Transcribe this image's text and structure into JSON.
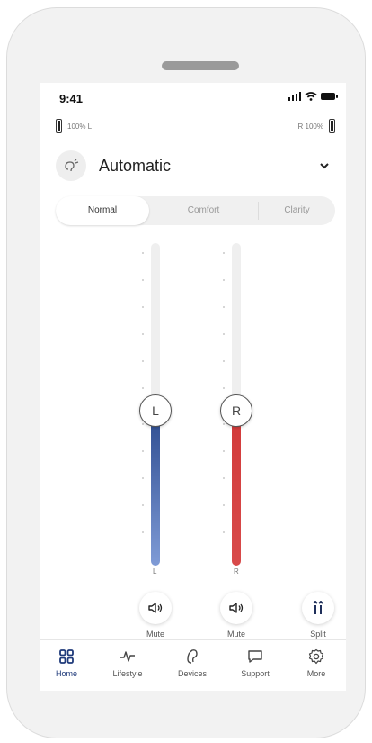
{
  "status": {
    "time": "9:41"
  },
  "battery": {
    "left_text": "100% L",
    "right_text": "R 100%"
  },
  "program": {
    "icon": "hearing-program-icon",
    "name": "Automatic"
  },
  "modes": {
    "items": [
      "Normal",
      "Comfort",
      "Clarity"
    ],
    "selected": "Normal"
  },
  "sliders": {
    "left": {
      "knob": "L",
      "bottom_label": "L",
      "color": "#2c4b8f",
      "level": 0.48
    },
    "right": {
      "knob": "R",
      "bottom_label": "R",
      "color": "#d23a3a",
      "level": 0.48
    }
  },
  "actions": {
    "mute_left": "Mute",
    "mute_right": "Mute",
    "split": "Split"
  },
  "tabs": [
    {
      "label": "Home",
      "icon": "home-grid-icon",
      "active": true
    },
    {
      "label": "Lifestyle",
      "icon": "activity-icon",
      "active": false
    },
    {
      "label": "Devices",
      "icon": "hearing-aid-icon",
      "active": false
    },
    {
      "label": "Support",
      "icon": "chat-bubble-icon",
      "active": false
    },
    {
      "label": "More",
      "icon": "gear-icon",
      "active": false
    }
  ],
  "colors": {
    "accent": "#1f3a7a",
    "left": "#2c4b8f",
    "right": "#d23a3a"
  }
}
